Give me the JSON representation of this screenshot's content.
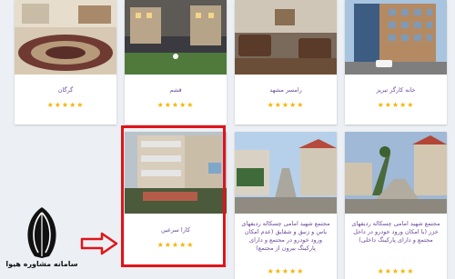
{
  "cards": [
    {
      "title": "گرگان",
      "rating": 5
    },
    {
      "title": "قشم",
      "rating": 5
    },
    {
      "title": "رامسر مشهد",
      "rating": 5
    },
    {
      "title": "خانه کارگر تبریز",
      "rating": 5
    },
    {
      "title": "کارا سرعین",
      "rating": 5
    },
    {
      "title": "مجتمع شهید امامی چسکاله ردیفهای یاس و زنبق و شقایق (عدم امکان ورود خودرو در مجتمع و دارای پارکینگ بیرون از مجتمع)",
      "rating": 5
    },
    {
      "title": "مجتمع شهید امامی چسکاله ردیفهای خزر (با امکان ورود خودرو در داخل مجتمع و دارای پارکینگ داخلی)",
      "rating": 5
    }
  ],
  "star_glyph": "★★★★★",
  "logo": {
    "name": "سامانه مشاوره هیوا"
  },
  "colors": {
    "title": "#6b4a9b",
    "star": "#f5b400",
    "highlight": "#e0141b",
    "arrow": "#e0141b"
  }
}
